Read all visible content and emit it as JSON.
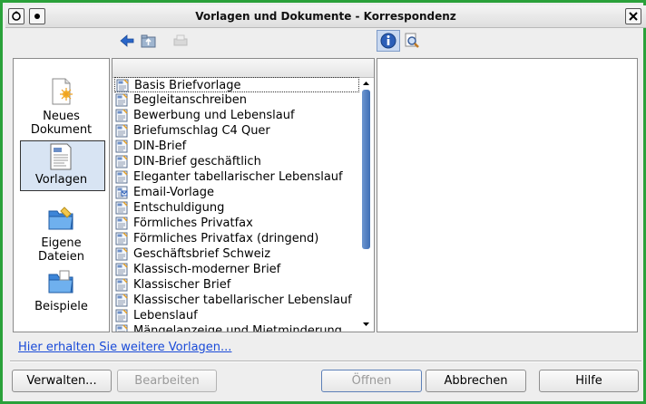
{
  "window": {
    "title": "Vorlagen und Dokumente - Korrespondenz"
  },
  "sidebar": {
    "items": [
      {
        "line1": "Neues",
        "line2": "Dokument",
        "icon": "new-document-icon",
        "selected": false
      },
      {
        "line1": "Vorlagen",
        "line2": "",
        "icon": "templates-icon",
        "selected": true
      },
      {
        "line1": "Eigene",
        "line2": "Dateien",
        "icon": "my-files-folder-icon",
        "selected": false
      },
      {
        "line1": "Beispiele",
        "line2": "",
        "icon": "samples-folder-icon",
        "selected": false
      }
    ]
  },
  "templates": {
    "items": [
      "Basis Briefvorlage",
      "Begleitanschreiben",
      "Bewerbung und Lebenslauf",
      "Briefumschlag C4 Quer",
      "DIN-Brief",
      "DIN-Brief geschäftlich",
      "Eleganter tabellarischer Lebenslauf",
      "Email-Vorlage",
      "Entschuldigung",
      "Förmliches Privatfax",
      "Förmliches Privatfax (dringend)",
      "Geschäftsbrief Schweiz",
      "Klassisch-moderner Brief",
      "Klassischer Brief",
      "Klassischer tabellarischer Lebenslauf",
      "Lebenslauf",
      "Mängelanzeige und Mietminderung"
    ]
  },
  "link": {
    "more_templates": "Hier erhalten Sie weitere Vorlagen..."
  },
  "buttons": {
    "manage": "Verwalten...",
    "edit": "Bearbeiten",
    "open": "Öffnen",
    "cancel": "Abbrechen",
    "help": "Hilfe"
  },
  "colors": {
    "accent": "#2aa13a",
    "link": "#1a4bd8",
    "selection": "#d8e4f3"
  }
}
